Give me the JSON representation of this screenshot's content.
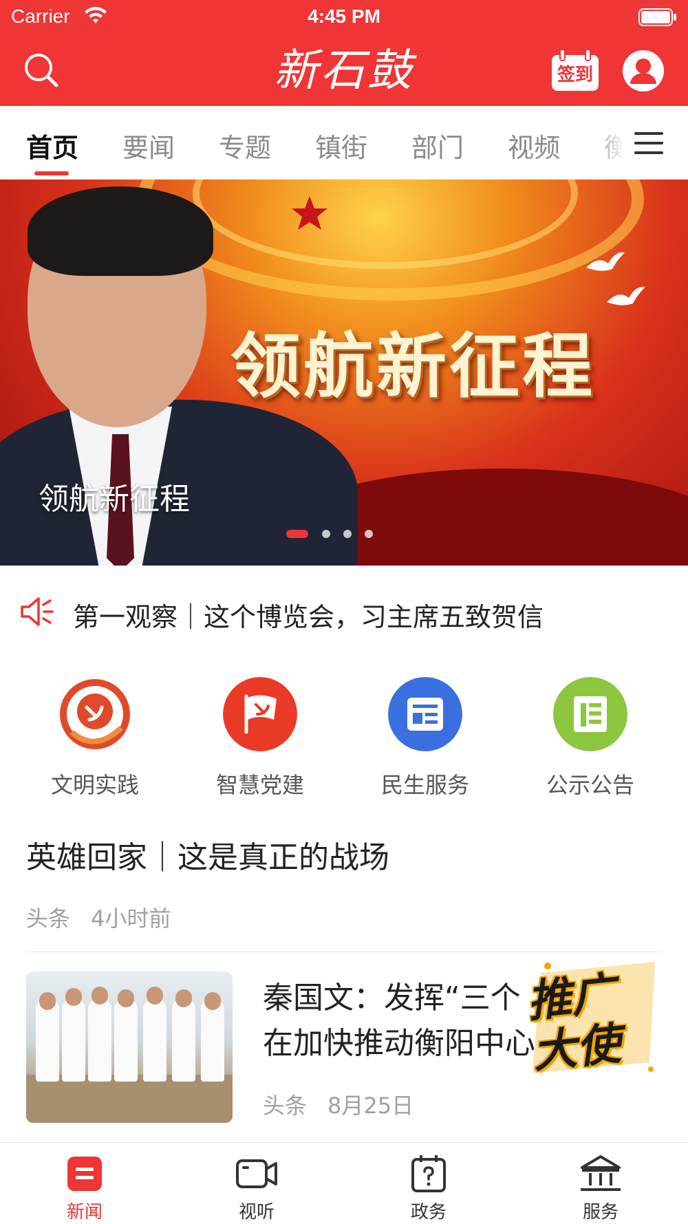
{
  "status_bar": {
    "carrier": "Carrier",
    "time": "4:45 PM"
  },
  "header": {
    "logo_text": "新石鼓",
    "signin_label": "签到",
    "accent_color": "#ef3536"
  },
  "tabs": [
    {
      "label": "首页",
      "active": true
    },
    {
      "label": "要闻",
      "active": false
    },
    {
      "label": "专题",
      "active": false
    },
    {
      "label": "镇街",
      "active": false
    },
    {
      "label": "部门",
      "active": false
    },
    {
      "label": "视频",
      "active": false
    },
    {
      "label": "衡",
      "active": false
    }
  ],
  "banner": {
    "headline": "领航新征程",
    "caption": "领航新征程",
    "slide_count": 4,
    "active_slide": 1
  },
  "ticker": {
    "text": "第一观察｜这个博览会，习主席五致贺信"
  },
  "services": [
    {
      "label": "文明实践",
      "icon": "civilization-practice-icon",
      "color": "#e04a2a"
    },
    {
      "label": "智慧党建",
      "icon": "party-flag-icon",
      "color": "#e83a2a"
    },
    {
      "label": "民生服务",
      "icon": "news-card-icon",
      "color": "#3a6fe0"
    },
    {
      "label": "公示公告",
      "icon": "notice-icon",
      "color": "#8cc63f"
    }
  ],
  "articles": [
    {
      "title": "英雄回家｜这是真正的战场",
      "source": "头条",
      "time": "4小时前"
    },
    {
      "title_line1": "秦国文：发挥“三个",
      "title_line2": "在加快推动衡阳中心",
      "source": "头条",
      "time": "8月25日"
    }
  ],
  "promo": {
    "text": "推广大使"
  },
  "bottom_nav": [
    {
      "label": "新闻",
      "icon": "news-icon",
      "active": true
    },
    {
      "label": "视听",
      "icon": "video-icon",
      "active": false
    },
    {
      "label": "政务",
      "icon": "government-affairs-icon",
      "active": false
    },
    {
      "label": "服务",
      "icon": "service-hall-icon",
      "active": false
    }
  ]
}
